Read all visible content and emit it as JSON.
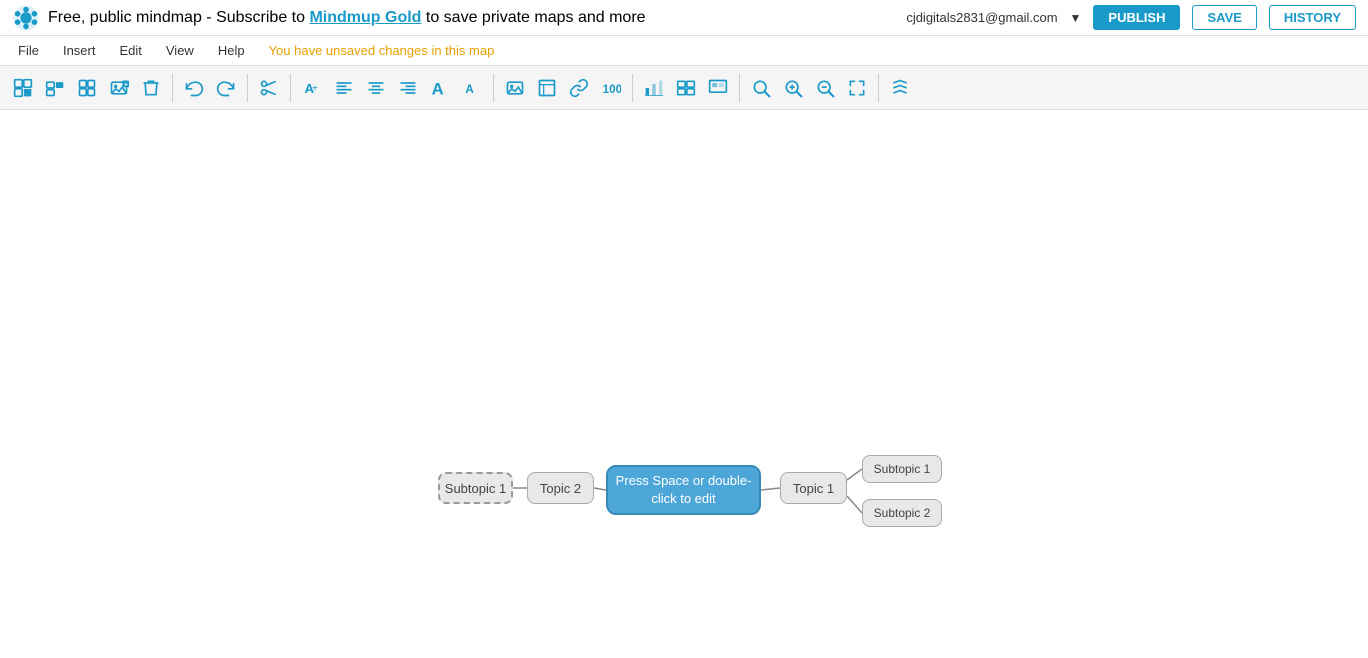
{
  "topbar": {
    "banner": "Free, public mindmap - Subscribe to ",
    "brand_link": "Mindmup Gold",
    "banner_suffix": " to save private maps and more",
    "user_email": "cjdigitals2831@gmail.com",
    "publish_label": "PUBLISH",
    "save_label": "SAVE",
    "history_label": "HISTORY"
  },
  "menubar": {
    "file_label": "File",
    "insert_label": "Insert",
    "edit_label": "Edit",
    "view_label": "View",
    "help_label": "Help",
    "unsaved_msg": "You have unsaved changes in this map"
  },
  "nodes": {
    "center": "Press Space or double-click to edit",
    "topic2": "Topic 2",
    "subtopic1_left": "Subtopic 1",
    "topic1": "Topic 1",
    "subtopic1_right": "Subtopic 1",
    "subtopic2_right": "Subtopic 2"
  },
  "colors": {
    "accent": "#1a9ac9",
    "center_bg": "#4da6d8",
    "node_bg": "#e8e8e8",
    "unsaved": "#e8a000"
  }
}
